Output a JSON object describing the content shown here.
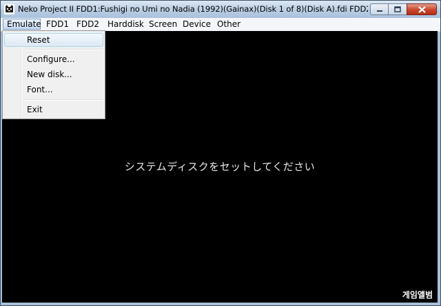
{
  "window": {
    "title": "Neko Project II  FDD1:Fushigi no Umi no Nadia (1992)(Gainax)(Disk 1 of 8)(Disk A).fdi  FDD2...",
    "icon": "neko-cat-icon",
    "buttons": {
      "minimize": "minimize-icon",
      "maximize": "maximize-icon",
      "close": "close-icon"
    }
  },
  "menubar": {
    "items": [
      {
        "label": "Emulate",
        "active": true
      },
      {
        "label": "FDD1"
      },
      {
        "label": "FDD2"
      },
      {
        "label": "Harddisk"
      },
      {
        "label": "Screen"
      },
      {
        "label": "Device"
      },
      {
        "label": "Other"
      }
    ]
  },
  "emulate_menu": {
    "items": [
      {
        "label": "Reset",
        "highlighted": true
      },
      {
        "label": "Configure..."
      },
      {
        "label": "New disk..."
      },
      {
        "label": "Font..."
      },
      {
        "label": "Exit"
      }
    ]
  },
  "screen": {
    "message": "システムディスクをセットしてください",
    "background": "#000000",
    "text_color": "#e8e8e8"
  },
  "watermark": "게임앨범",
  "colors": {
    "close_button": "#c9462b",
    "titlebar": "#b9cde3",
    "menu_highlight": "#c7daf1"
  }
}
